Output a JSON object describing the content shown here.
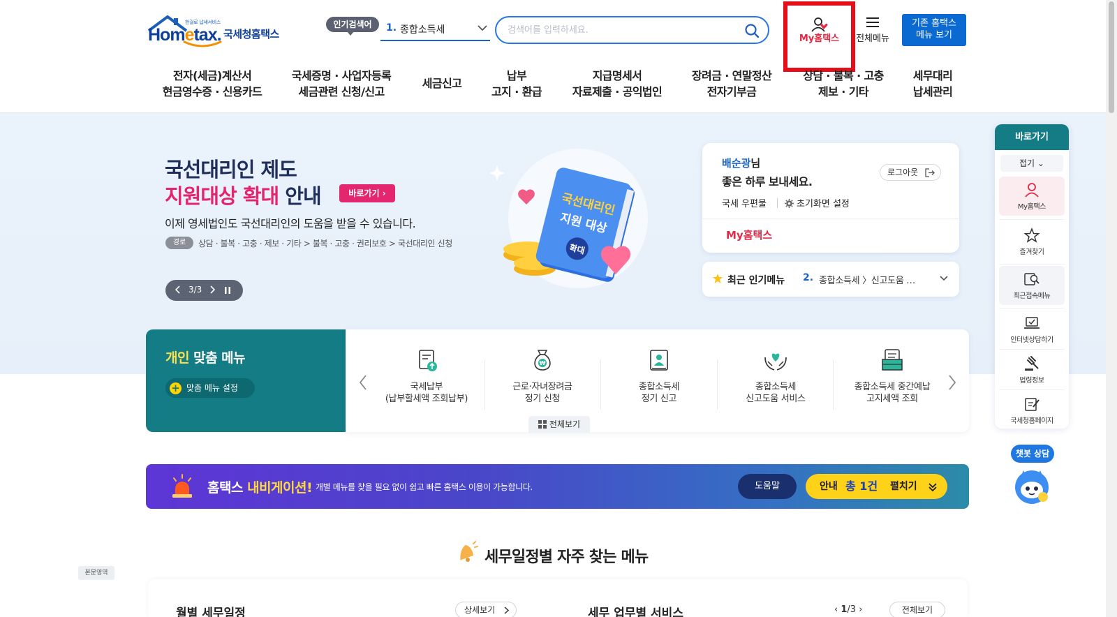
{
  "header": {
    "logo": {
      "tagline": "한걸로 납세서비스",
      "brand_pre": "Hom",
      "brand_e": "e",
      "brand_post": "tax.",
      "name": "국세청홈택스"
    },
    "popular": {
      "badge": "인기검색어",
      "rank": "1.",
      "term": "종합소득세"
    },
    "search": {
      "placeholder": "검색어를 입력하세요.",
      "value": ""
    },
    "my_hometax": "My홈택스",
    "all_menu": "전체메뉴",
    "old_menu": [
      "기존 홈택스",
      "메뉴 보기"
    ],
    "gnb": [
      {
        "l1": "전자(세금)계산서",
        "l2": "현금영수증 · 신용카드"
      },
      {
        "l1": "국세증명 · 사업자등록",
        "l2": "세금관련 신청/신고"
      },
      {
        "l1": "세금신고",
        "l2": ""
      },
      {
        "l1": "납부",
        "l2": "고지 · 환급"
      },
      {
        "l1": "지급명세서",
        "l2": "자료제출 · 공익법인"
      },
      {
        "l1": "장려금 · 연말정산",
        "l2": "전자기부금"
      },
      {
        "l1": "상담 · 불복 · 고충",
        "l2": "제보 · 기타"
      },
      {
        "l1": "세무대리",
        "l2": "납세관리"
      }
    ]
  },
  "hero": {
    "title1": "국선대리인 제도",
    "title2_hi": "지원대상 확대",
    "title2_rest": " 안내",
    "go_button": "바로가기",
    "description": "이제 영세법인도 국선대리인의 도움을 받을 수 있습니다.",
    "path_badge": "경로",
    "path": "상담 · 불복 · 고충 · 제보 · 기타 > 불복 · 고충 · 권리보호 > 국선대리인 신청",
    "pager": "3/3",
    "illus_text1": "국선대리인",
    "illus_text2": "지원 대상",
    "illus_text3": "확대"
  },
  "user_card": {
    "name": "배순광",
    "name_suffix": "님",
    "greeting": "좋은 하루 보내세요.",
    "logout": "로그아웃",
    "post": "국세 우편물",
    "setting": "초기화면 설정",
    "my_hometax": "My홈택스"
  },
  "hot_menu": {
    "title": "최근 인기메뉴",
    "rank": "2.",
    "text": "종합소득세 〉신고도움 …"
  },
  "personal_menu": {
    "title_hi": "개인",
    "title_rest": " 맞춤 메뉴",
    "setting": "맞춤 메뉴 설정",
    "items": [
      {
        "l1": "국세납부",
        "l2": "(납부할세액 조회납부)"
      },
      {
        "l1": "근로·자녀장려금",
        "l2": "정기 신청"
      },
      {
        "l1": "종합소득세",
        "l2": "정기 신고"
      },
      {
        "l1": "종합소득세",
        "l2": "신고도움 서비스"
      },
      {
        "l1": "종합소득세 중간예납",
        "l2": "고지세액 조회"
      }
    ],
    "view_all": "전체보기"
  },
  "navi_banner": {
    "title_pre": "홈택스 ",
    "title_hi": "내비게이션!",
    "desc": "개별 메뉴를 찾을 필요 없이 쉽고 빠른 홈택스 이용이 가능합니다.",
    "help": "도움말",
    "info_a": "안내",
    "info_b": "총 1건",
    "info_c": "펼치기"
  },
  "schedule": {
    "title": "세무일정별 자주 찾는 메뉴",
    "monthly": "월별 세무일정",
    "detail": "상세보기",
    "service": "세무 업무별 서비스",
    "pager_cur": "1",
    "pager_total": "/3",
    "view_all": "전체보기"
  },
  "body_area_tag": "본문영역",
  "quick": {
    "head": "바로가기",
    "fold": "접기",
    "items": [
      {
        "label": "My홈택스",
        "icon": "person-icon"
      },
      {
        "label": "즐겨찾기",
        "icon": "star-icon"
      },
      {
        "label": "최근접속메뉴",
        "icon": "recent-search-icon"
      },
      {
        "label": "인터넷상담하기",
        "icon": "laptop-check-icon"
      },
      {
        "label": "법령정보",
        "icon": "gavel-icon"
      },
      {
        "label": "국세청홈페이지",
        "icon": "edit-doc-icon"
      }
    ]
  },
  "chatbot": "챗봇 상담",
  "colors": {
    "brand_blue": "#0b6ad1",
    "teal": "#137c85",
    "accent_pink": "#e4266f",
    "highlight_red": "#e3101b"
  }
}
